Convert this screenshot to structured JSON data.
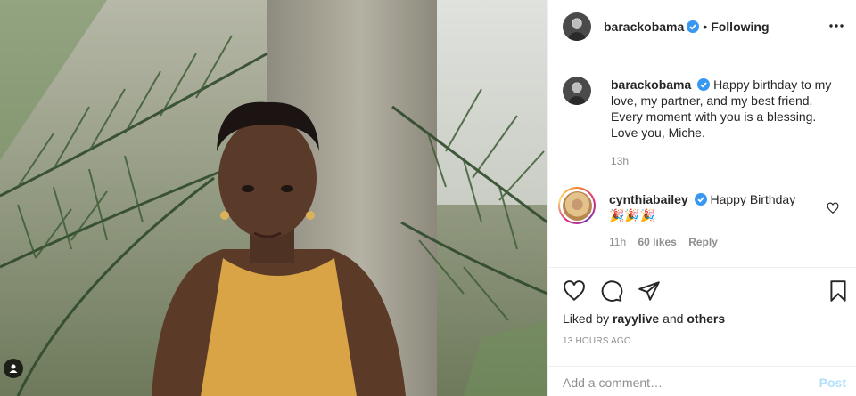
{
  "post": {
    "photo_alt": "photo",
    "author": "barackobama",
    "dot": "•",
    "follow_status": "Following"
  },
  "caption": {
    "username": "barackobama",
    "text": "Happy birthday to my love, my partner, and my best friend. Every moment with you is a blessing. Love you, Miche.",
    "time": "13h"
  },
  "comment": {
    "username": "cynthiabailey",
    "text": "Happy Birthday",
    "emoji": "🎉🎉🎉",
    "time": "11h",
    "likes": "60 likes",
    "reply_label": "Reply"
  },
  "likes_line": {
    "prefix": "Liked by",
    "user": "rayylive",
    "and": "and",
    "others": "others"
  },
  "timestamp": "13 HOURS AGO",
  "composer": {
    "placeholder": "Add a comment…",
    "post_label": "Post"
  },
  "colors": {
    "verified": "#3897f0",
    "text": "#262626",
    "muted": "#8e8e8e",
    "post_disabled": "#b2dffc"
  },
  "icons": [
    "more-options-icon",
    "verified-icon",
    "heart-icon",
    "comment-icon",
    "share-icon",
    "bookmark-icon",
    "user-tag-icon"
  ]
}
